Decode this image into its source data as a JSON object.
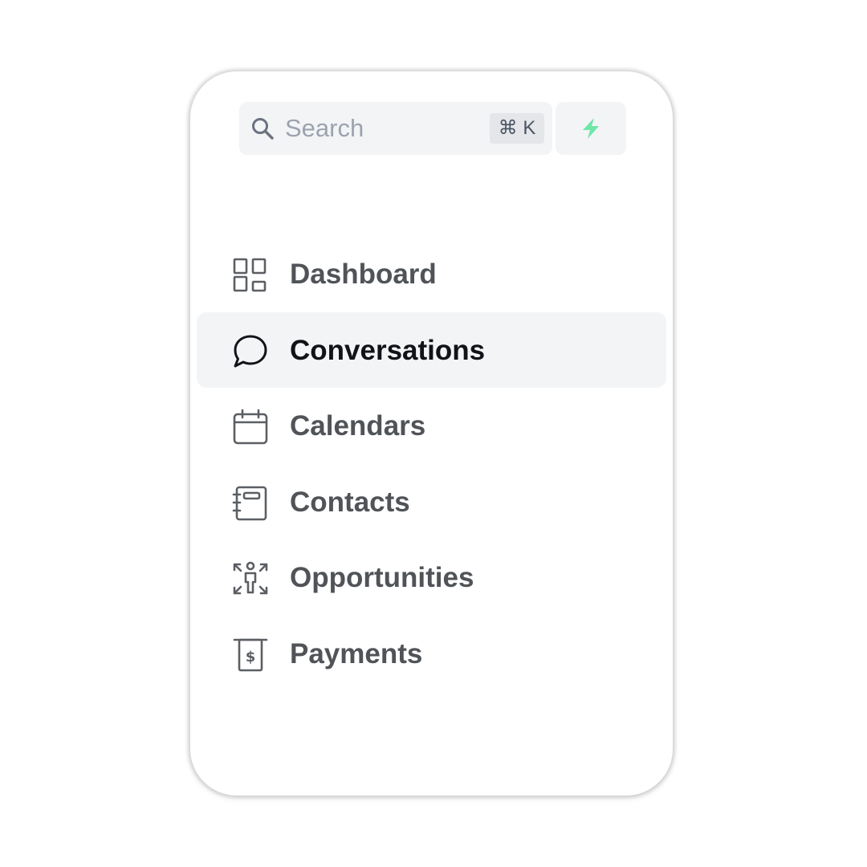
{
  "search": {
    "placeholder": "Search",
    "shortcut": "⌘ K"
  },
  "quick_action": {
    "icon": "lightning-bolt-icon",
    "color": "#6ee7a8"
  },
  "sidebar": {
    "active_index": 1,
    "items": [
      {
        "label": "Dashboard",
        "icon": "dashboard-grid-icon"
      },
      {
        "label": "Conversations",
        "icon": "chat-bubble-icon"
      },
      {
        "label": "Calendars",
        "icon": "calendar-icon"
      },
      {
        "label": "Contacts",
        "icon": "contact-book-icon"
      },
      {
        "label": "Opportunities",
        "icon": "opportunities-icon"
      },
      {
        "label": "Payments",
        "icon": "payment-receipt-icon"
      }
    ]
  },
  "colors": {
    "active_background": "#f3f4f6",
    "text": "#505357",
    "active_text": "#111318",
    "placeholder": "#9ca3af"
  }
}
